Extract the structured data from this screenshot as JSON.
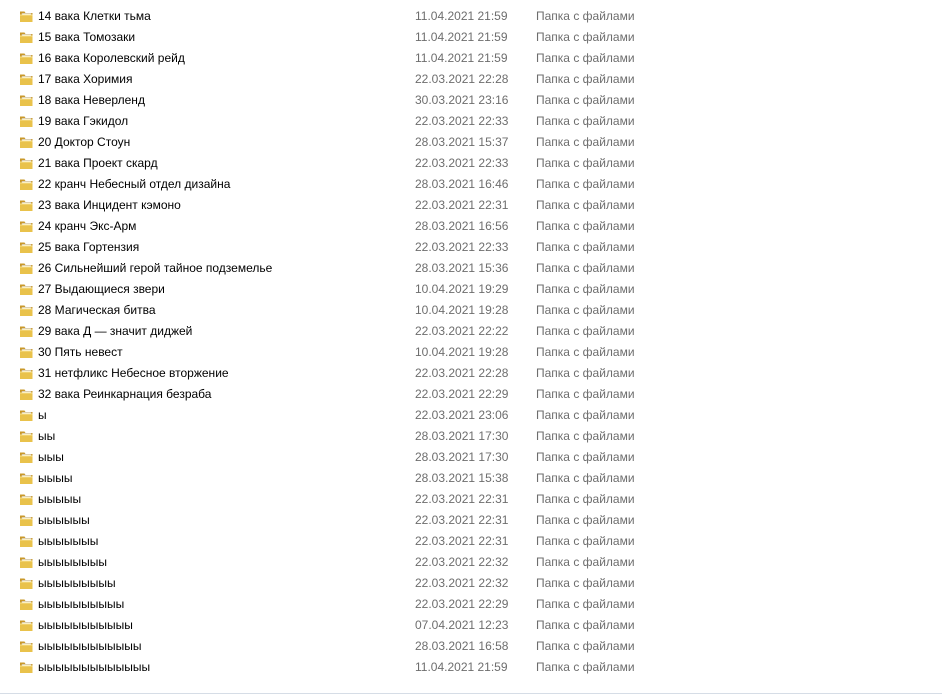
{
  "colors": {
    "name_text": "#000000",
    "meta_text": "#6d6d6d",
    "folder_light": "#f7e08c",
    "folder_mid": "#e9c24b",
    "folder_dark": "#c9982a",
    "paper": "#ffffff"
  },
  "icon": "folder-icon",
  "files": [
    {
      "name": "14 вака Клетки тьма",
      "date": "11.04.2021 21:59",
      "type": "Папка с файлами"
    },
    {
      "name": "15 вака Томозаки",
      "date": "11.04.2021 21:59",
      "type": "Папка с файлами"
    },
    {
      "name": "16 вака Королевский рейд",
      "date": "11.04.2021 21:59",
      "type": "Папка с файлами"
    },
    {
      "name": "17 вака Хоримия",
      "date": "22.03.2021 22:28",
      "type": "Папка с файлами"
    },
    {
      "name": "18 вака Неверленд",
      "date": "30.03.2021 23:16",
      "type": "Папка с файлами"
    },
    {
      "name": "19 вака Гэкидол",
      "date": "22.03.2021 22:33",
      "type": "Папка с файлами"
    },
    {
      "name": "20 Доктор Стоун",
      "date": "28.03.2021 15:37",
      "type": "Папка с файлами"
    },
    {
      "name": "21 вака Проект скард",
      "date": "22.03.2021 22:33",
      "type": "Папка с файлами"
    },
    {
      "name": "22 кранч Небесный отдел дизайна",
      "date": "28.03.2021 16:46",
      "type": "Папка с файлами"
    },
    {
      "name": "23 вака Инцидент кэмоно",
      "date": "22.03.2021 22:31",
      "type": "Папка с файлами"
    },
    {
      "name": "24 кранч Экс-Арм",
      "date": "28.03.2021 16:56",
      "type": "Папка с файлами"
    },
    {
      "name": "25 вака Гортензия",
      "date": "22.03.2021 22:33",
      "type": "Папка с файлами"
    },
    {
      "name": "26 Сильнейший герой тайное подземелье",
      "date": "28.03.2021 15:36",
      "type": "Папка с файлами"
    },
    {
      "name": "27 Выдающиеся звери",
      "date": "10.04.2021 19:29",
      "type": "Папка с файлами"
    },
    {
      "name": "28 Магическая битва",
      "date": "10.04.2021 19:28",
      "type": "Папка с файлами"
    },
    {
      "name": "29 вака Д — значит диджей",
      "date": "22.03.2021 22:22",
      "type": "Папка с файлами"
    },
    {
      "name": "30 Пять невест",
      "date": "10.04.2021 19:28",
      "type": "Папка с файлами"
    },
    {
      "name": "31 нетфликс Небесное вторжение",
      "date": "22.03.2021 22:28",
      "type": "Папка с файлами"
    },
    {
      "name": "32 вака Реинкарнация безраба",
      "date": "22.03.2021 22:29",
      "type": "Папка с файлами"
    },
    {
      "name": "ы",
      "date": "22.03.2021 23:06",
      "type": "Папка с файлами"
    },
    {
      "name": "ыы",
      "date": "28.03.2021 17:30",
      "type": "Папка с файлами"
    },
    {
      "name": "ыыы",
      "date": "28.03.2021 17:30",
      "type": "Папка с файлами"
    },
    {
      "name": "ыыыы",
      "date": "28.03.2021 15:38",
      "type": "Папка с файлами"
    },
    {
      "name": "ыыыыы",
      "date": "22.03.2021 22:31",
      "type": "Папка с файлами"
    },
    {
      "name": "ыыыыыы",
      "date": "22.03.2021 22:31",
      "type": "Папка с файлами"
    },
    {
      "name": "ыыыыыыы",
      "date": "22.03.2021 22:31",
      "type": "Папка с файлами"
    },
    {
      "name": "ыыыыыыыы",
      "date": "22.03.2021 22:32",
      "type": "Папка с файлами"
    },
    {
      "name": "ыыыыыыыыы",
      "date": "22.03.2021 22:32",
      "type": "Папка с файлами"
    },
    {
      "name": "ыыыыыыыыыы",
      "date": "22.03.2021 22:29",
      "type": "Папка с файлами"
    },
    {
      "name": "ыыыыыыыыыыы",
      "date": "07.04.2021 12:23",
      "type": "Папка с файлами"
    },
    {
      "name": "ыыыыыыыыыыыы",
      "date": "28.03.2021 16:58",
      "type": "Папка с файлами"
    },
    {
      "name": "ыыыыыыыыыыыыы",
      "date": "11.04.2021 21:59",
      "type": "Папка с файлами"
    }
  ]
}
